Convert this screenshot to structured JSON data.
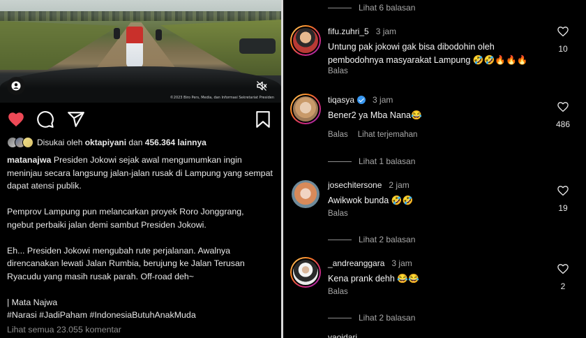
{
  "post": {
    "video": {
      "copyright_text": "©2023 Biro Pers, Media, dan Informasi Sekretariat Presiden",
      "user_tag_icon": "user-tag-icon",
      "mute_icon": "speaker-muted-icon"
    },
    "actions": {
      "like_icon": "heart-filled-icon",
      "comment_icon": "comment-bubble-icon",
      "share_icon": "paper-plane-icon",
      "save_icon": "bookmark-icon",
      "like_color": "#ed4956"
    },
    "likes": {
      "prefix": "Disukai oleh",
      "user": "oktapiyani",
      "mid": "dan",
      "count": "456.364 lainnya"
    },
    "caption": {
      "username": "matanajwa",
      "lines": [
        "Presiden Jokowi sejak awal mengumumkan ingin",
        "meninjau secara langsung jalan-jalan rusak di Lampung yang sempat",
        "dapat atensi publik.",
        "",
        "Pemprov Lampung pun melancarkan proyek Roro Jonggrang,",
        "ngebut perbaiki jalan demi sambut Presiden Jokowi.",
        "",
        "Eh... Presiden Jokowi mengubah rute perjalanan. Awalnya",
        "direncanakan lewati Jalan Rumbia, berujung ke Jalan Terusan",
        "Ryacudu yang masih rusak parah. Off-road deh~",
        "",
        "| Mata Najwa",
        "#Narasi #JadiPaham #IndonesiaButuhAnakMuda"
      ]
    },
    "view_all_comments": "Lihat semua 23.055 komentar"
  },
  "comments_panel": {
    "reply_threads": [
      {
        "label": "Lihat 6 balasan"
      },
      {
        "label": "Lihat 1 balasan"
      },
      {
        "label": "Lihat 2 balasan"
      },
      {
        "label": "Lihat 2 balasan"
      }
    ],
    "comments": [
      {
        "username": "fifu.zuhri_5",
        "time": "3 jam",
        "text": "Untung pak jokowi gak bisa dibodohin oleh pembodohnya masyarakat Lampung 🤣🤣🔥🔥🔥",
        "reply": "Balas",
        "likes": "10",
        "verified": false
      },
      {
        "username": "tiqasya",
        "time": "3 jam",
        "text": "Bener2 ya Mba Nana😂",
        "reply": "Balas",
        "translate": "Lihat terjemahan",
        "likes": "486",
        "verified": true
      },
      {
        "username": "josechitersone",
        "time": "2 jam",
        "text": "Awikwok bunda 🤣🤣",
        "reply": "Balas",
        "likes": "19",
        "verified": false
      },
      {
        "username": "_andreanggara",
        "time": "3 jam",
        "text": "Kena prank dehh 😂😂",
        "reply": "Balas",
        "likes": "2",
        "verified": false
      }
    ],
    "partial_username": "vaoidari"
  }
}
